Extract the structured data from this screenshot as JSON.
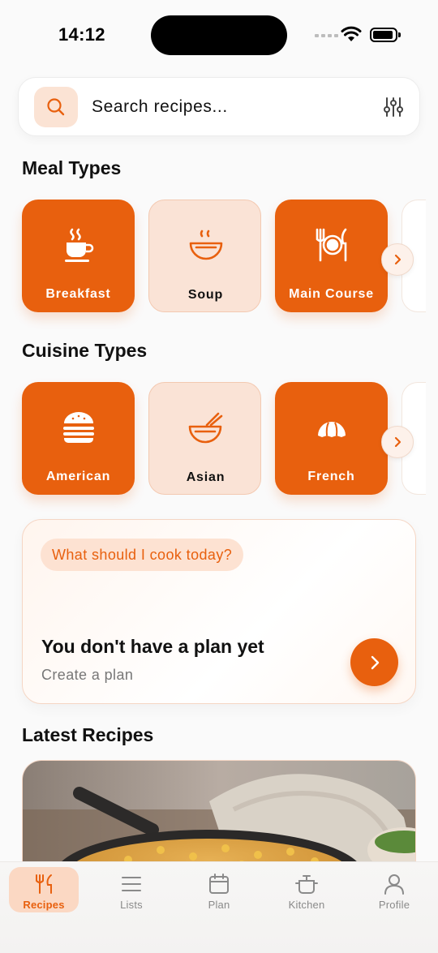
{
  "status_bar": {
    "time": "14:12"
  },
  "search": {
    "placeholder": "Search recipes..."
  },
  "meal_types": {
    "title": "Meal Types",
    "items": [
      {
        "label": "Breakfast",
        "icon": "coffee-cup-icon",
        "style": "solid"
      },
      {
        "label": "Soup",
        "icon": "soup-bowl-icon",
        "style": "soft"
      },
      {
        "label": "Main Course",
        "icon": "plate-cutlery-icon",
        "style": "solid"
      }
    ]
  },
  "cuisine_types": {
    "title": "Cuisine Types",
    "items": [
      {
        "label": "American",
        "icon": "burger-icon",
        "style": "solid"
      },
      {
        "label": "Asian",
        "icon": "noodle-bowl-icon",
        "style": "soft"
      },
      {
        "label": "French",
        "icon": "croissant-icon",
        "style": "solid"
      }
    ]
  },
  "plan_card": {
    "chip": "What should I cook today?",
    "title": "You don't have a plan yet",
    "subtitle": "Create a plan"
  },
  "latest_recipes": {
    "title": "Latest Recipes"
  },
  "tab_bar": {
    "tabs": [
      {
        "label": "Recipes",
        "icon": "fork-knife-icon",
        "active": true
      },
      {
        "label": "Lists",
        "icon": "list-icon",
        "active": false
      },
      {
        "label": "Plan",
        "icon": "calendar-icon",
        "active": false
      },
      {
        "label": "Kitchen",
        "icon": "pot-icon",
        "active": false
      },
      {
        "label": "Profile",
        "icon": "person-icon",
        "active": false
      }
    ]
  },
  "colors": {
    "accent": "#e8600e",
    "accent_soft": "#fae3d6",
    "background": "#fafafa"
  }
}
